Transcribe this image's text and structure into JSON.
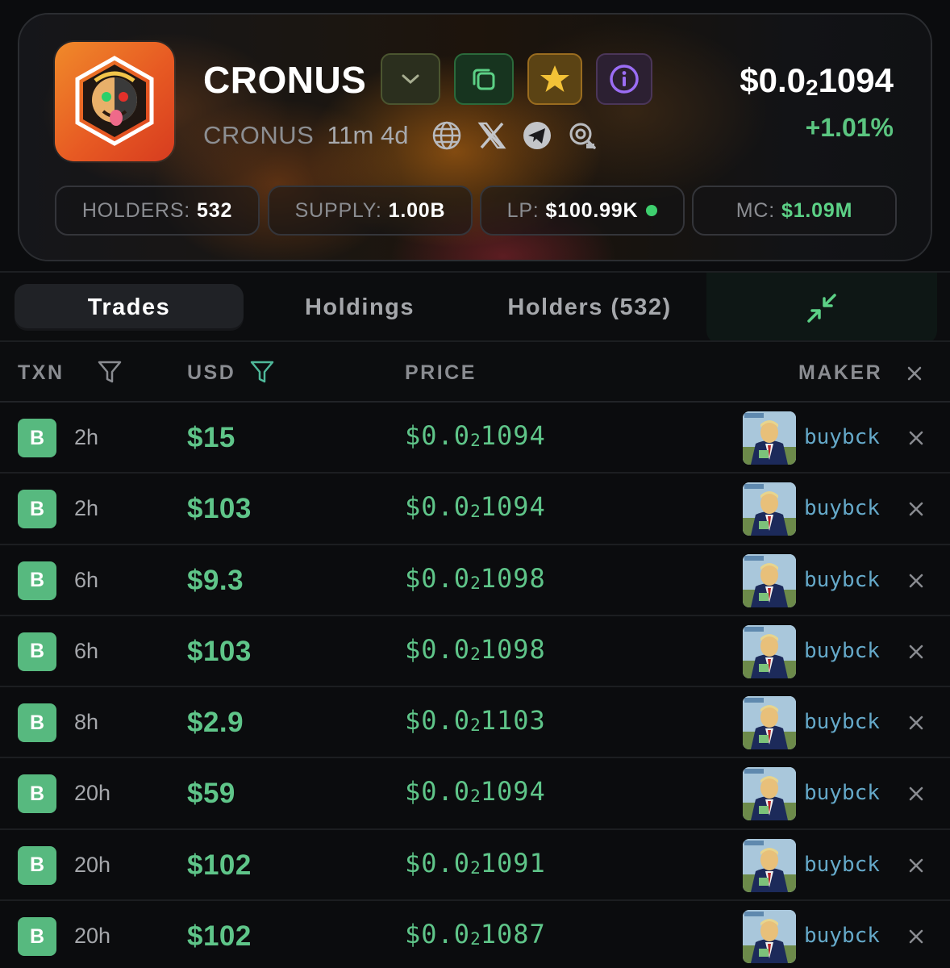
{
  "token": {
    "name": "CRONUS",
    "ticker": "CRONUS",
    "age": "11m 4d",
    "price_prefix": "$0.0",
    "price_subscript": "2",
    "price_rest": "1094",
    "change": "+1.01%",
    "colors": {
      "accent_green": "#5fc589",
      "star": "#f3c237",
      "info": "#8b5cf6"
    }
  },
  "header_buttons": [
    {
      "icon": "chevron-down-icon"
    },
    {
      "icon": "copy-icon"
    },
    {
      "icon": "star-icon"
    },
    {
      "icon": "info-icon"
    }
  ],
  "social_icons": [
    "globe-icon",
    "x-icon",
    "telegram-icon",
    "search-link-icon"
  ],
  "stats": {
    "holders": {
      "label": "HOLDERS:",
      "value": "532"
    },
    "supply": {
      "label": "SUPPLY:",
      "value": "1.00B"
    },
    "lp": {
      "label": "LP:",
      "value": "$100.99K"
    },
    "mc": {
      "label": "MC:",
      "value": "$1.09M"
    }
  },
  "tabs": {
    "trades": "Trades",
    "holdings": "Holdings",
    "holders": "Holders (532)"
  },
  "table": {
    "headers": {
      "txn": "TXN",
      "usd": "USD",
      "price": "PRICE",
      "maker": "MAKER"
    },
    "rows": [
      {
        "type": "B",
        "time": "2h",
        "usd": "$15",
        "price_prefix": "$0.0",
        "price_sub": "2",
        "price_rest": "1094",
        "maker": "buybck"
      },
      {
        "type": "B",
        "time": "2h",
        "usd": "$103",
        "price_prefix": "$0.0",
        "price_sub": "2",
        "price_rest": "1094",
        "maker": "buybck"
      },
      {
        "type": "B",
        "time": "6h",
        "usd": "$9.3",
        "price_prefix": "$0.0",
        "price_sub": "2",
        "price_rest": "1098",
        "maker": "buybck"
      },
      {
        "type": "B",
        "time": "6h",
        "usd": "$103",
        "price_prefix": "$0.0",
        "price_sub": "2",
        "price_rest": "1098",
        "maker": "buybck"
      },
      {
        "type": "B",
        "time": "8h",
        "usd": "$2.9",
        "price_prefix": "$0.0",
        "price_sub": "2",
        "price_rest": "1103",
        "maker": "buybck"
      },
      {
        "type": "B",
        "time": "20h",
        "usd": "$59",
        "price_prefix": "$0.0",
        "price_sub": "2",
        "price_rest": "1094",
        "maker": "buybck"
      },
      {
        "type": "B",
        "time": "20h",
        "usd": "$102",
        "price_prefix": "$0.0",
        "price_sub": "2",
        "price_rest": "1091",
        "maker": "buybck"
      },
      {
        "type": "B",
        "time": "20h",
        "usd": "$102",
        "price_prefix": "$0.0",
        "price_sub": "2",
        "price_rest": "1087",
        "maker": "buybck"
      }
    ]
  }
}
